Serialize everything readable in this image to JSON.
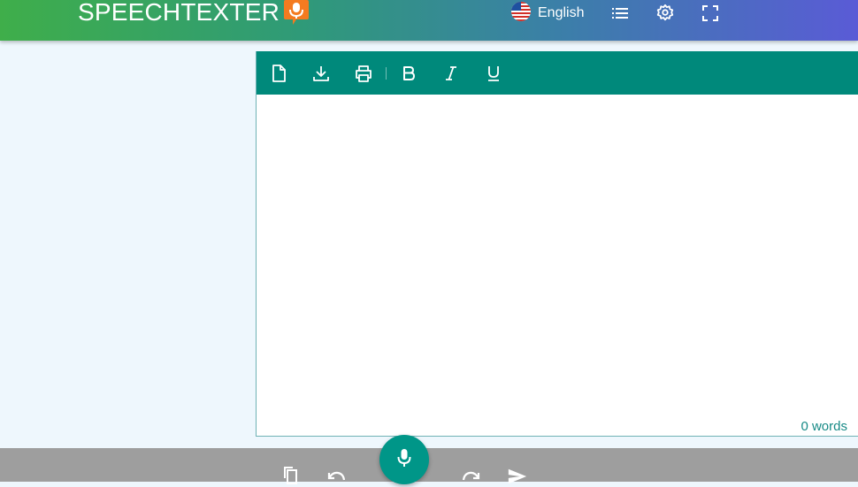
{
  "header": {
    "logo_text": "SPEECHTEXTER",
    "language": "English",
    "icons": [
      "microphone-icon",
      "us-flag-icon",
      "list-icon",
      "gear-icon",
      "fullscreen-icon"
    ]
  },
  "editor": {
    "toolbar_icons": [
      "new-document-icon",
      "download-icon",
      "print-icon",
      "bold-icon",
      "italic-icon",
      "underline-icon"
    ],
    "content": "",
    "word_count": "0 words"
  },
  "bottom_bar": {
    "icons": [
      "copy-icon",
      "undo-icon",
      "microphone-icon",
      "redo-icon",
      "send-icon"
    ]
  },
  "colors": {
    "header_gradient_start": "#3fae4a",
    "header_gradient_end": "#5a5bd6",
    "toolbar": "#00897b",
    "mic_button": "#009688",
    "logo_mic": "#f47b20",
    "page_background": "#eef7fd",
    "bottom_bar": "#9e9e9e"
  }
}
